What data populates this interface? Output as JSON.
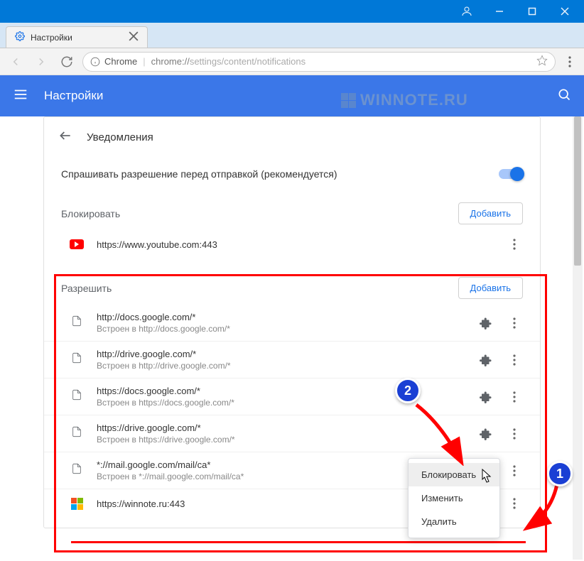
{
  "window": {
    "tab_title": "Настройки",
    "address_label": "Chrome",
    "url_prefix": "chrome://",
    "url_path": "settings/content/notifications"
  },
  "header": {
    "title": "Настройки"
  },
  "page": {
    "title": "Уведомления",
    "ask_permission_label": "Спрашивать разрешение перед отправкой (рекомендуется)"
  },
  "sections": {
    "block": {
      "title": "Блокировать",
      "add": "Добавить",
      "items": [
        {
          "url": "https://www.youtube.com:443",
          "icon": "youtube"
        }
      ]
    },
    "allow": {
      "title": "Разрешить",
      "add": "Добавить",
      "items": [
        {
          "url": "http://docs.google.com/*",
          "sub": "Встроен в http://docs.google.com/*",
          "icon": "doc",
          "ext": true
        },
        {
          "url": "http://drive.google.com/*",
          "sub": "Встроен в http://drive.google.com/*",
          "icon": "doc",
          "ext": true
        },
        {
          "url": "https://docs.google.com/*",
          "sub": "Встроен в https://docs.google.com/*",
          "icon": "doc",
          "ext": true
        },
        {
          "url": "https://drive.google.com/*",
          "sub": "Встроен в https://drive.google.com/*",
          "icon": "doc",
          "ext": true
        },
        {
          "url": "*://mail.google.com/mail/ca*",
          "sub": "Встроен в *://mail.google.com/mail/ca*",
          "icon": "doc",
          "ext": true
        },
        {
          "url": "https://winnote.ru:443",
          "icon": "microsoft"
        }
      ]
    }
  },
  "context_menu": {
    "items": [
      "Блокировать",
      "Изменить",
      "Удалить"
    ]
  },
  "watermark": "WINNOTE.RU",
  "annotations": {
    "badge1": "1",
    "badge2": "2"
  }
}
